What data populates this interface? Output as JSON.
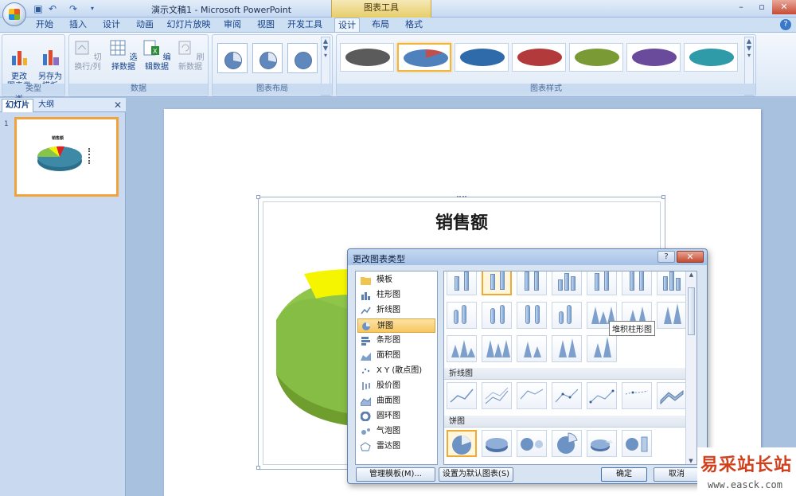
{
  "window": {
    "doc_title": "演示文稿1 - Microsoft PowerPoint",
    "context_tool": "图表工具",
    "min": "–",
    "max": "▫",
    "close": "✕",
    "help": "?"
  },
  "tabs": [
    "开始",
    "插入",
    "设计",
    "动画",
    "幻灯片放映",
    "审阅",
    "视图",
    "开发工具",
    "设计",
    "布局",
    "格式"
  ],
  "ribbon": {
    "type_group": {
      "label": "类型",
      "change_type": "更改\n图表类型",
      "save_template": "另存为\n模板"
    },
    "data_group": {
      "label": "数据",
      "switch_row_col": "切换行/列",
      "select_data": "选择数据",
      "edit_data": "编辑数据",
      "refresh_data": "刷新数据"
    },
    "layout_group": {
      "label": "图表布局"
    },
    "style_group": {
      "label": "图表样式"
    }
  },
  "style_colors": [
    "#5b5b5b",
    "#4f81bd",
    "#2f6bab",
    "#b33a3a",
    "#7a9a35",
    "#6a4a9a",
    "#2f9aa8"
  ],
  "left_pane": {
    "tab_slides": "幻灯片",
    "tab_outline": "大纲",
    "close": "✕",
    "slide_number": "1",
    "thumb_title": "销售额"
  },
  "chart": {
    "title": "销售额"
  },
  "dialog": {
    "title": "更改图表类型",
    "help": "?",
    "close": "✕",
    "types": [
      "模板",
      "柱形图",
      "折线图",
      "饼图",
      "条形图",
      "面积图",
      "X Y (散点图)",
      "股价图",
      "曲面图",
      "圆环图",
      "气泡图",
      "雷达图"
    ],
    "selected_type": "饼图",
    "section_line": "折线图",
    "section_pie": "饼图",
    "tooltip": "堆积柱形图",
    "btn_manage": "管理模板(M)...",
    "btn_default": "设置为默认图表(S)",
    "btn_ok": "确定",
    "btn_cancel": "取消"
  },
  "watermark": {
    "cn": "易采站长站",
    "url": "www.easck.com"
  }
}
